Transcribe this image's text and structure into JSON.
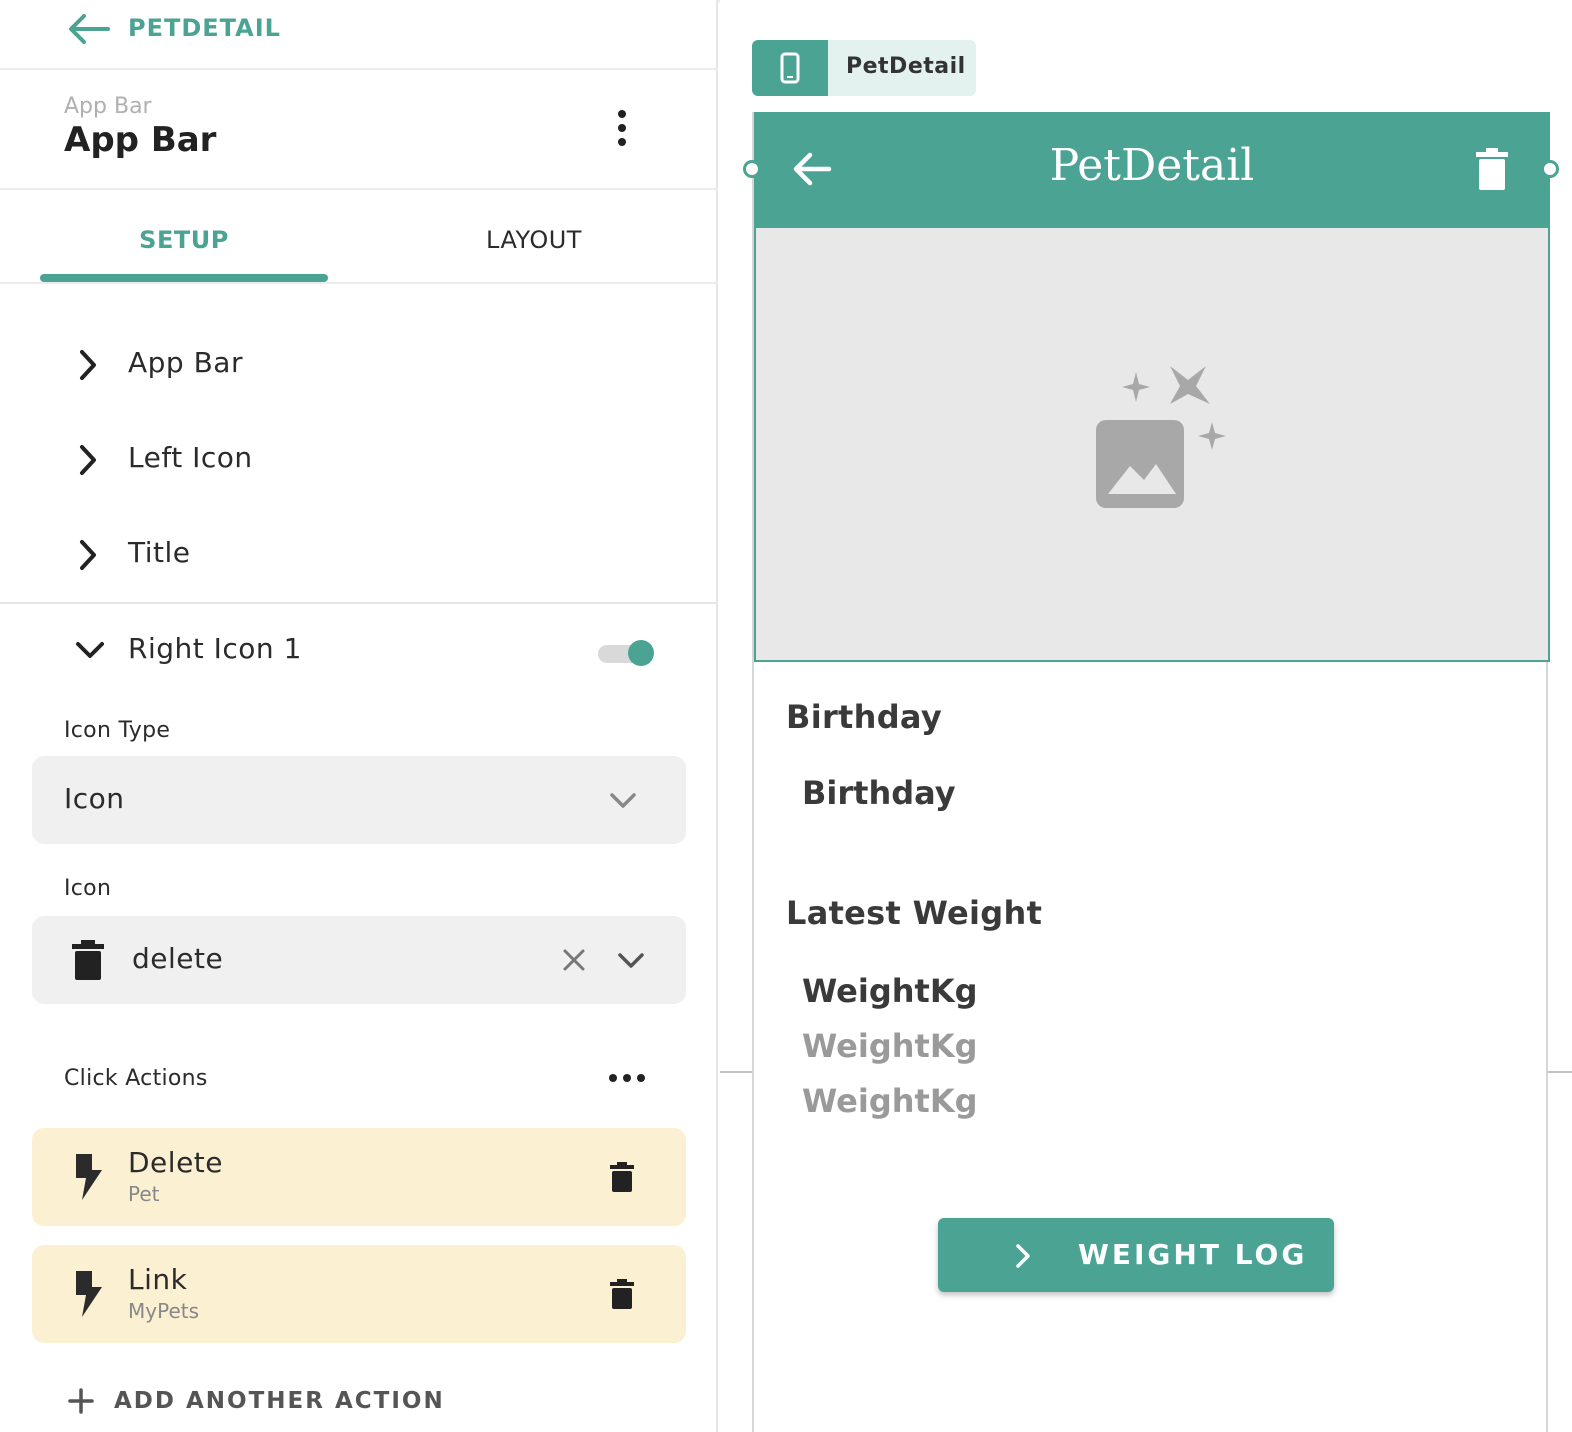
{
  "nav": {
    "back_icon": "arrow-left-icon",
    "crumb": "PETDETAIL"
  },
  "panel": {
    "subtitle": "App Bar",
    "title": "App Bar",
    "menu_icon": "kebab-menu-icon"
  },
  "tabs": [
    {
      "label": "SETUP",
      "active": true
    },
    {
      "label": "LAYOUT",
      "active": false
    }
  ],
  "sections": [
    {
      "label": "App Bar",
      "expanded": false
    },
    {
      "label": "Left Icon",
      "expanded": false
    },
    {
      "label": "Title",
      "expanded": false
    },
    {
      "label": "Right Icon 1",
      "expanded": true,
      "enabled": true
    }
  ],
  "icon_type": {
    "label": "Icon Type",
    "value": "Icon"
  },
  "icon": {
    "label": "Icon",
    "value": "delete",
    "glyph": "trash-icon"
  },
  "click_actions": {
    "label": "Click Actions",
    "items": [
      {
        "name": "Delete",
        "detail": "Pet"
      },
      {
        "name": "Link",
        "detail": "MyPets"
      }
    ],
    "add_label": "ADD ANOTHER ACTION"
  },
  "canvas": {
    "page_tag": "PetDetail",
    "appbar_title": "PetDetail",
    "birthday_heading": "Birthday",
    "birthday_value": "Birthday",
    "weight_heading": "Latest Weight",
    "weights": [
      "WeightKg",
      "WeightKg",
      "WeightKg"
    ],
    "button_label": "WEIGHT LOG"
  },
  "colors": {
    "accent": "#4ba394",
    "action_bg": "#fcf0d2",
    "field_bg": "#f0f0f0",
    "placeholder_bg": "#e8e8e8"
  }
}
